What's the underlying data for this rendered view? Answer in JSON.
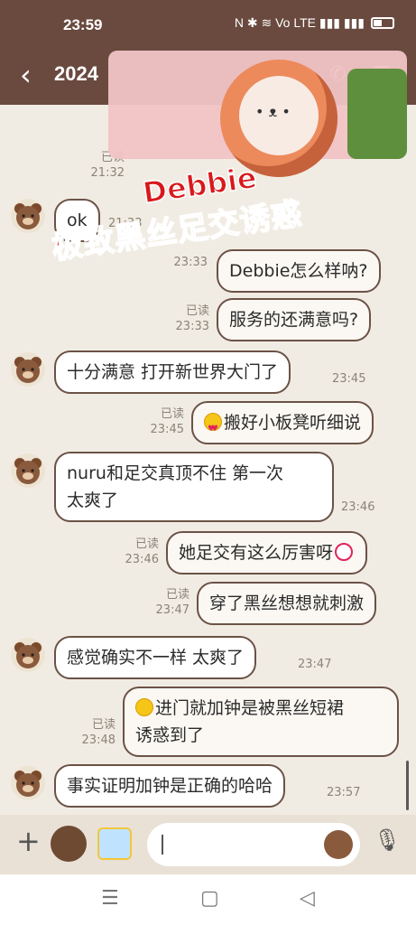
{
  "status_bar": {
    "time": "23:59",
    "icons": "N ✱ ≋ Vo LTE ▮▮▮ ▮▮▮"
  },
  "header": {
    "title": "2024"
  },
  "overlay": {
    "title_line1": "Debbie",
    "title_line2": "极致黑丝足交诱惑"
  },
  "messages": [
    {
      "side": "right",
      "read": "已读",
      "time": "21:32"
    },
    {
      "side": "left",
      "text": "ok",
      "time": "21:33"
    },
    {
      "side": "right",
      "read": "",
      "time": "23:33",
      "text": "Debbie怎么样呐?"
    },
    {
      "side": "right",
      "read": "已读",
      "time": "23:33",
      "text": "服务的还满意吗?"
    },
    {
      "side": "left",
      "text": "十分满意 打开新世界大门了",
      "time": "23:45"
    },
    {
      "side": "right",
      "read": "已读",
      "time": "23:45",
      "text": "搬好小板凳听细说"
    },
    {
      "side": "left",
      "text_line1": "nuru和足交真顶不住 第一次",
      "text_line2": "太爽了",
      "time": "23:46"
    },
    {
      "side": "right",
      "read": "已读",
      "time": "23:46",
      "text": "她足交有这么厉害呀"
    },
    {
      "side": "right",
      "read": "已读",
      "time": "23:47",
      "text": "穿了黑丝想想就刺激"
    },
    {
      "side": "left",
      "text": "感觉确实不一样 太爽了",
      "time": "23:47"
    },
    {
      "side": "right",
      "read": "已读",
      "time": "23:48",
      "text_line1": "进门就加钟是被黑丝短裙",
      "text_line2": "诱惑到了"
    },
    {
      "side": "left",
      "text": "事实证明加钟是正确的哈哈",
      "time": "23:57"
    }
  ],
  "input": {
    "placeholder": ""
  },
  "icons": {
    "back": "‹",
    "search": "⌕",
    "call": "✆",
    "menu": "☰",
    "plus": "+",
    "mic": "🎙",
    "nav_menu": "☰",
    "nav_home": "▢",
    "nav_back": "◁"
  },
  "colors": {
    "header": "#6a4a3f",
    "background": "#f1ece3",
    "bubble_border": "#6b5246"
  }
}
